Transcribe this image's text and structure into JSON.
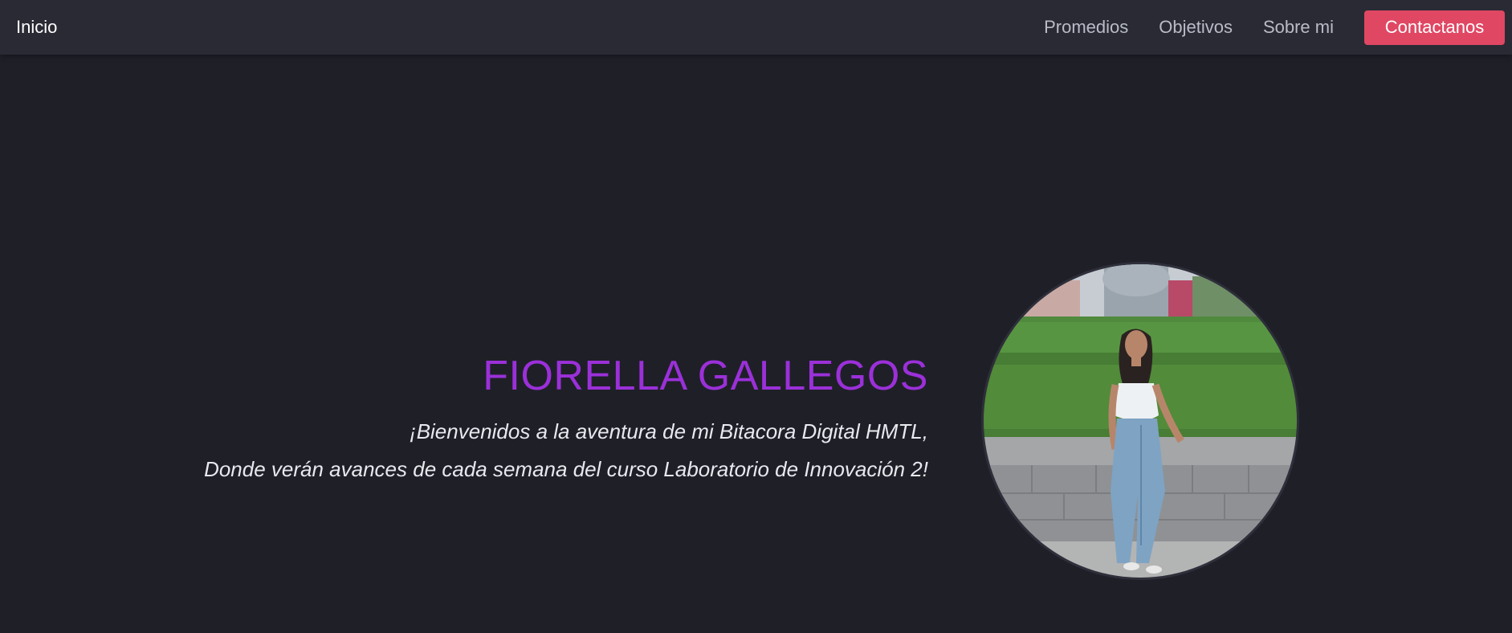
{
  "nav": {
    "brand": "Inicio",
    "links": [
      "Promedios",
      "Objetivos",
      "Sobre mi"
    ],
    "contact": "Contactanos"
  },
  "hero": {
    "title": "FIORELLA GALLEGOS",
    "line1": "¡Bienvenidos a la aventura de mi Bitacora Digital HMTL,",
    "line2": "Donde verán avances de cada semana del curso Laboratorio de Innovación 2!"
  },
  "colors": {
    "background": "#1f1f28",
    "navbar": "#292a34",
    "accent": "#e04763",
    "title": "#9b30d9"
  }
}
